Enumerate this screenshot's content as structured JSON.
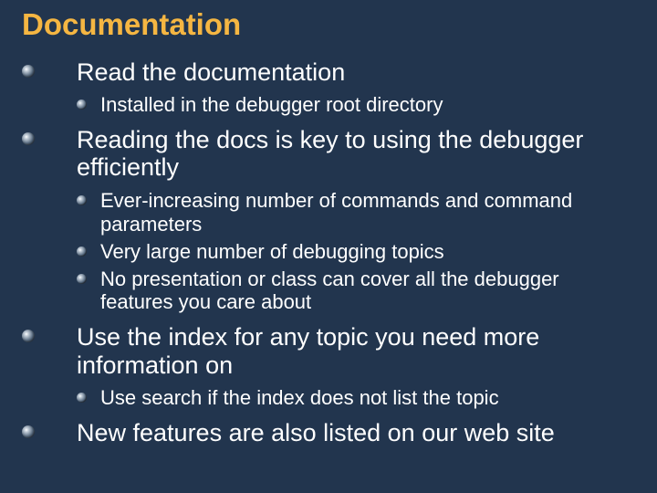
{
  "title": "Documentation",
  "items": [
    {
      "text": "Read the documentation",
      "sub": [
        "Installed in the debugger root directory"
      ]
    },
    {
      "text": "Reading the docs is key to using the debugger efficiently",
      "sub": [
        "Ever-increasing number of commands and command parameters",
        "Very large number of debugging topics",
        "No presentation or class can cover all the debugger features you care about"
      ]
    },
    {
      "text": "Use the index for any topic you need more information on",
      "sub": [
        "Use search if the index does not list the topic"
      ]
    },
    {
      "text": "New features are also listed on our web site",
      "sub": []
    }
  ]
}
